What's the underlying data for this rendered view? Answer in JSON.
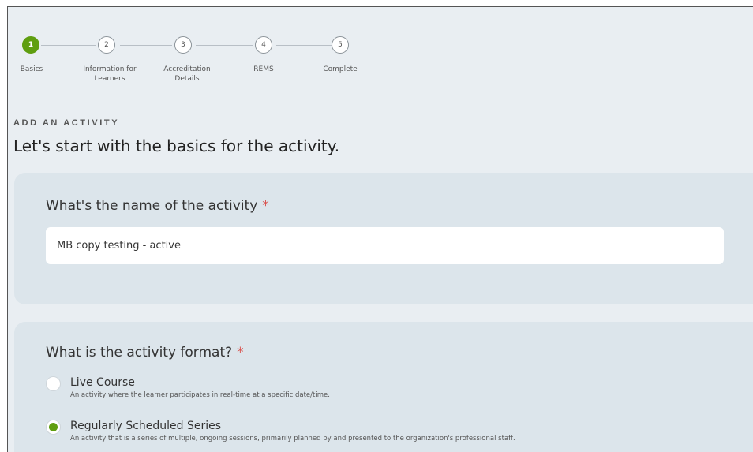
{
  "stepper": {
    "steps": [
      {
        "number": "1",
        "label": "Basics",
        "active": true
      },
      {
        "number": "2",
        "label_line1": "Information for",
        "label_line2": "Learners",
        "active": false
      },
      {
        "number": "3",
        "label_line1": "Accreditation",
        "label_line2": "Details",
        "active": false
      },
      {
        "number": "4",
        "label": "REMS",
        "active": false
      },
      {
        "number": "5",
        "label": "Complete",
        "active": false
      }
    ]
  },
  "header": {
    "eyebrow": "ADD AN ACTIVITY",
    "headline": "Let's start with the basics for the activity."
  },
  "name_section": {
    "question": "What's the name of the activity",
    "required_mark": "*",
    "value": "MB copy testing - active"
  },
  "format_section": {
    "question": "What is the activity format?",
    "required_mark": "*",
    "options": [
      {
        "label": "Live Course",
        "description": "An activity where the learner participates in real-time at a specific date/time.",
        "selected": false
      },
      {
        "label": "Regularly Scheduled Series",
        "description": "An activity that is a series of multiple, ongoing sessions, primarily planned by and presented to the organization's professional staff.",
        "selected": true
      }
    ]
  },
  "colors": {
    "accent": "#5f9e10",
    "required": "#d9534f",
    "card_bg": "#dce5eb",
    "page_bg": "#e9eef2"
  }
}
